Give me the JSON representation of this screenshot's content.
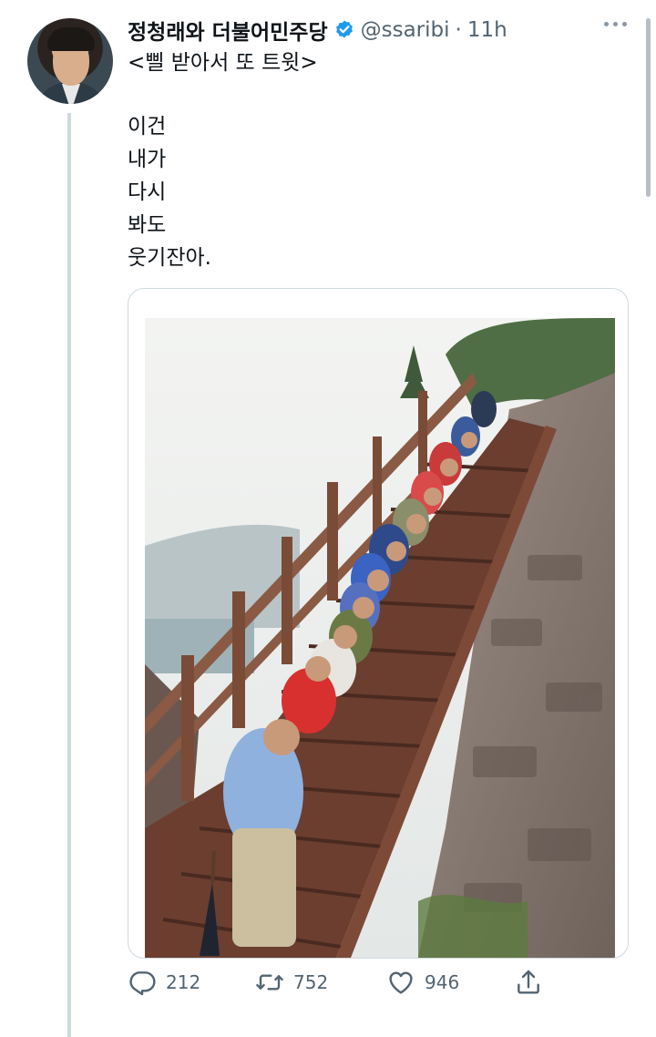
{
  "tweet": {
    "display_name": "정청래와 더불어민주당",
    "handle": "@ssaribi",
    "separator": "·",
    "time": "11h",
    "verified": true,
    "text_lines": [
      "<삘 받아서 또 트윗>",
      "이건",
      "내가",
      "다시",
      "봐도",
      "웃기잔아."
    ]
  },
  "actions": {
    "reply_count": "212",
    "retweet_count": "752",
    "like_count": "946"
  },
  "icons": {
    "avatar": "avatar",
    "verified": "verified-badge-icon",
    "more": "more-icon",
    "reply": "reply-icon",
    "retweet": "retweet-icon",
    "like": "like-icon",
    "share": "share-icon"
  },
  "colors": {
    "verified_blue": "#1d9bf0",
    "secondary_text": "#536471",
    "thread_line": "#cfd9de"
  }
}
